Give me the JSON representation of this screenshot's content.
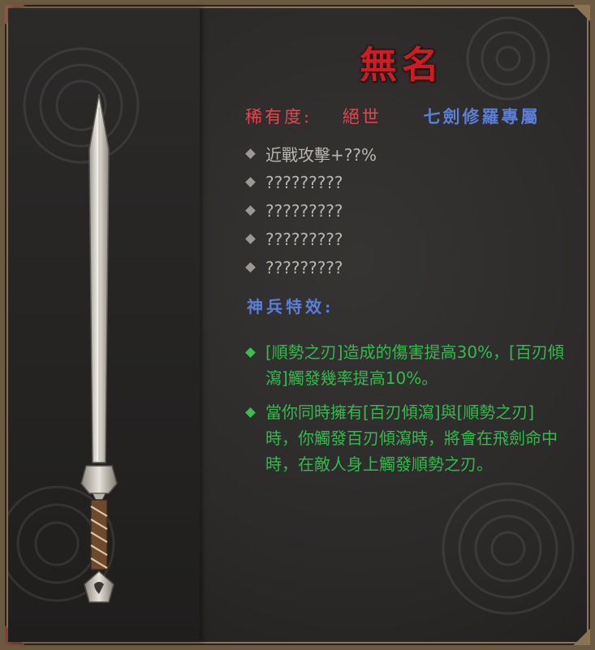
{
  "item": {
    "name": "無名",
    "rarity_label": "稀有度:",
    "rarity_value": "絕世",
    "exclusive": "七劍修羅專屬"
  },
  "stats": [
    "近戰攻擊+??%",
    "?????????",
    "?????????",
    "?????????",
    "?????????"
  ],
  "effects_header": "神兵特效:",
  "effects": [
    "[順勢之刃]造成的傷害提高30%，[百刃傾瀉]觸發幾率提高10%。",
    "當你同時擁有[百刃傾瀉]與[順勢之刃]時，你觸發百刃傾瀉時，將會在飛劍命中時，在敵人身上觸發順勢之刃。"
  ],
  "colors": {
    "title": "#d21a22",
    "rarity": "#e04852",
    "exclusive": "#5b7fd8",
    "effect_text": "#35b94d",
    "stat_text": "#b9b6b1"
  },
  "icons": {
    "bullet": "diamond-icon",
    "item_image": "sword-icon"
  }
}
